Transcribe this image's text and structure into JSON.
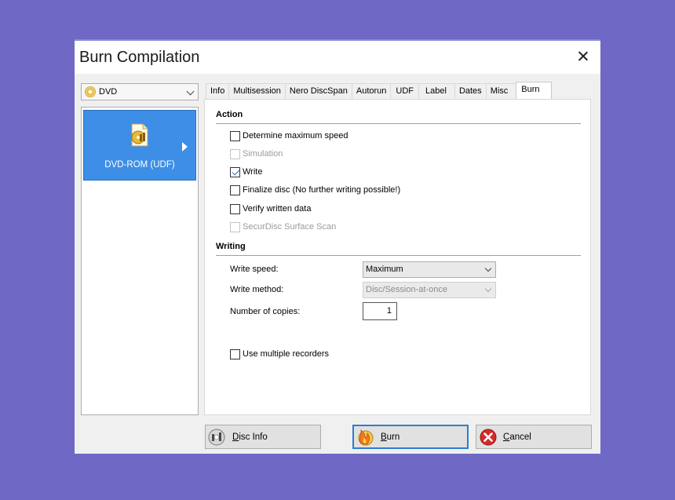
{
  "window": {
    "title": "Burn Compilation"
  },
  "media": {
    "selected": "DVD",
    "item_label": "DVD-ROM (UDF)"
  },
  "tabs": [
    {
      "label": "Info",
      "active": false
    },
    {
      "label": "Multisession",
      "active": false
    },
    {
      "label": "Nero DiscSpan",
      "active": false
    },
    {
      "label": "Autorun",
      "active": false
    },
    {
      "label": "UDF",
      "active": false
    },
    {
      "label": "Label",
      "active": false
    },
    {
      "label": "Dates",
      "active": false
    },
    {
      "label": "Misc",
      "active": false
    },
    {
      "label": "Burn",
      "active": true
    }
  ],
  "action": {
    "heading": "Action",
    "options": [
      {
        "label": "Determine maximum speed",
        "checked": false,
        "enabled": true
      },
      {
        "label": "Simulation",
        "checked": false,
        "enabled": false
      },
      {
        "label": "Write",
        "checked": true,
        "enabled": true
      },
      {
        "label": "Finalize disc (No further writing possible!)",
        "checked": false,
        "enabled": true
      },
      {
        "label": "Verify written data",
        "checked": false,
        "enabled": true
      },
      {
        "label": "SecurDisc Surface Scan",
        "checked": false,
        "enabled": false
      }
    ]
  },
  "writing": {
    "heading": "Writing",
    "write_speed_label": "Write speed:",
    "write_speed_value": "Maximum",
    "write_method_label": "Write method:",
    "write_method_value": "Disc/Session-at-once",
    "copies_label": "Number of copies:",
    "copies_value": "1",
    "multiple_recorders_label": "Use multiple recorders"
  },
  "buttons": {
    "disc_info": {
      "first": "D",
      "rest": "isc Info"
    },
    "burn": {
      "first": "B",
      "rest": "urn"
    },
    "cancel": {
      "first": "C",
      "rest": "ancel"
    }
  }
}
